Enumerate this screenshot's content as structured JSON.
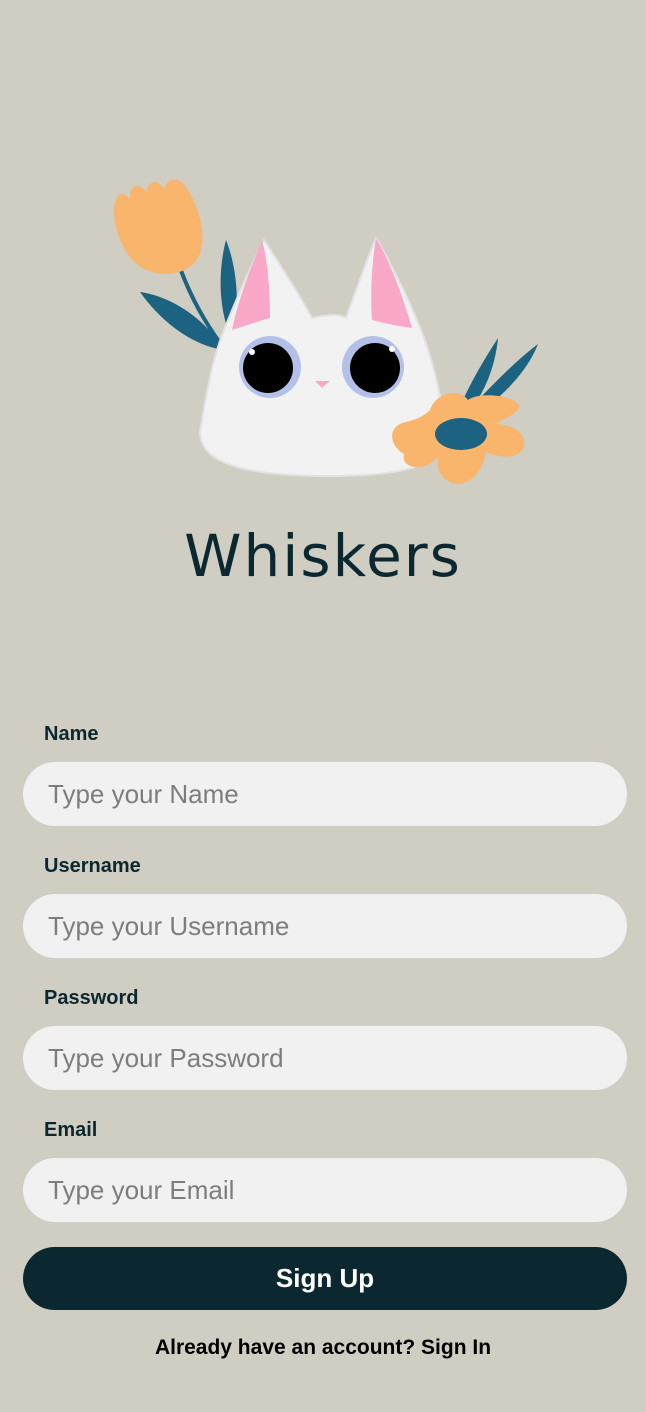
{
  "app": {
    "title": "Whiskers"
  },
  "form": {
    "fields": [
      {
        "label": "Name",
        "placeholder": "Type your Name",
        "value": ""
      },
      {
        "label": "Username",
        "placeholder": "Type your Username",
        "value": ""
      },
      {
        "label": "Password",
        "placeholder": "Type your Password",
        "value": ""
      },
      {
        "label": "Email",
        "placeholder": "Type your Email",
        "value": ""
      }
    ],
    "submit_label": "Sign Up"
  },
  "footer": {
    "prompt": "Already have an account?",
    "link_label": "Sign In"
  },
  "colors": {
    "background": "#d0cdc2",
    "primary": "#0b2830",
    "input_bg": "#f1f1f1",
    "flower_orange": "#f9b56c",
    "leaf_teal": "#1b6380",
    "ear_pink": "#f9a8c8"
  }
}
